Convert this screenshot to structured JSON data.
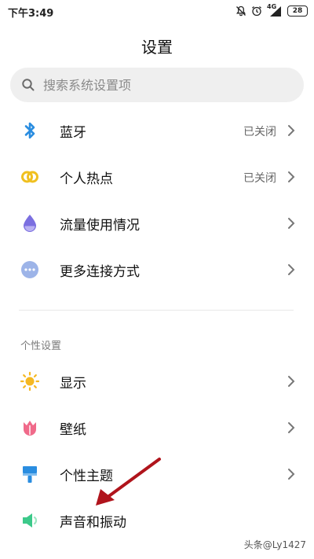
{
  "status_bar": {
    "time": "下午3:49",
    "network": "4G",
    "battery": "28"
  },
  "page": {
    "title": "设置"
  },
  "search": {
    "placeholder": "搜索系统设置项"
  },
  "connectivity": {
    "items": [
      {
        "label": "蓝牙",
        "value": "已关闭",
        "icon": "bluetooth-icon"
      },
      {
        "label": "个人热点",
        "value": "已关闭",
        "icon": "hotspot-icon"
      },
      {
        "label": "流量使用情况",
        "value": "",
        "icon": "data-usage-icon"
      },
      {
        "label": "更多连接方式",
        "value": "",
        "icon": "more-connections-icon"
      }
    ]
  },
  "personal": {
    "header": "个性设置",
    "items": [
      {
        "label": "显示",
        "icon": "sun-icon"
      },
      {
        "label": "壁纸",
        "icon": "tulip-icon"
      },
      {
        "label": "个性主题",
        "icon": "brush-icon"
      },
      {
        "label": "声音和振动",
        "icon": "speaker-icon"
      }
    ]
  },
  "watermark": "头条@Ly1427",
  "colors": {
    "bluetooth": "#2a8de0",
    "hotspot": "#f0c020",
    "data_usage": "#7b6fe0",
    "more": "#9db4e8",
    "display": "#f5b822",
    "wallpaper": "#f06a8a",
    "theme": "#2a8de0",
    "sound": "#3cc98a",
    "annotation_arrow": "#b0141c"
  }
}
